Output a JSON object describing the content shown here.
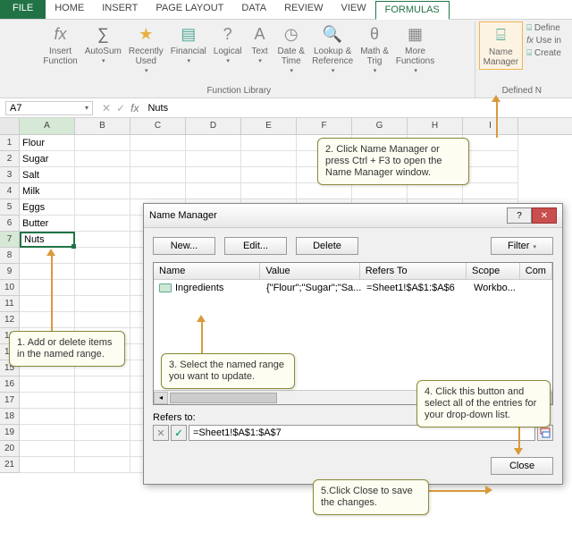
{
  "tabs": {
    "file": "FILE",
    "items": [
      "HOME",
      "INSERT",
      "PAGE LAYOUT",
      "DATA",
      "REVIEW",
      "VIEW",
      "FORMULAS"
    ],
    "active": "FORMULAS"
  },
  "ribbon": {
    "insert_function": "Insert\nFunction",
    "autosum": "AutoSum",
    "recently_used": "Recently\nUsed",
    "financial": "Financial",
    "logical": "Logical",
    "text": "Text",
    "date_time": "Date &\nTime",
    "lookup_ref": "Lookup &\nReference",
    "math_trig": "Math &\nTrig",
    "more_func": "More\nFunctions",
    "name_manager": "Name\nManager",
    "group_label": "Function Library",
    "defined_names_label": "Defined N",
    "define": "Define",
    "use_in": "Use in",
    "create": "Create"
  },
  "namebox": "A7",
  "formula": "Nuts",
  "columns": [
    "A",
    "B",
    "C",
    "D",
    "E",
    "F",
    "G",
    "H",
    "I"
  ],
  "rows_count": 21,
  "cells": [
    "Flour",
    "Sugar",
    "Salt",
    "Milk",
    "Eggs",
    "Butter",
    "Nuts"
  ],
  "active_row": 7,
  "dialog": {
    "title": "Name Manager",
    "new": "New...",
    "edit": "Edit...",
    "delete": "Delete",
    "filter": "Filter",
    "headers": {
      "name": "Name",
      "value": "Value",
      "refers": "Refers To",
      "scope": "Scope",
      "com": "Com"
    },
    "row": {
      "name": "Ingredients",
      "value": "{\"Flour\";\"Sugar\";\"Sa...",
      "refers": "=Sheet1!$A$1:$A$6",
      "scope": "Workbo..."
    },
    "refers_label": "Refers to:",
    "refers_value": "=Sheet1!$A$1:$A$7",
    "close": "Close"
  },
  "callouts": {
    "c1": "1. Add or delete items in the named range.",
    "c2": "2. Click Name Manager or press Ctrl + F3 to open the Name Manager window.",
    "c3": "3. Select the named range you want to update.",
    "c4": "4. Click this button and select all of the entries for your drop-down list.",
    "c5": "5.Click Close to save the changes."
  }
}
